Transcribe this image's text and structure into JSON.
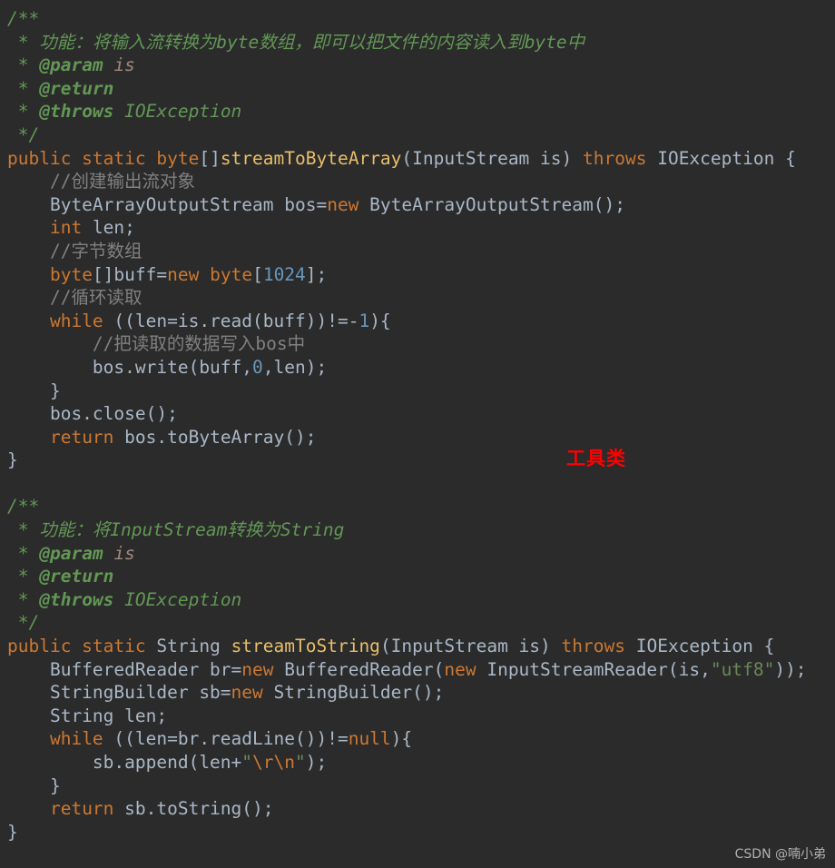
{
  "editor": {
    "background_color": "#2b2b2b",
    "default_text_color": "#a9b7c6",
    "language": "Java",
    "lines": [
      {
        "tokens": [
          {
            "t": "/**",
            "c": "t-doc"
          }
        ]
      },
      {
        "tokens": [
          {
            "t": " * ",
            "c": "t-doc"
          },
          {
            "t": "功能：将输入流转换为byte数组，即可以把文件的内容读入到byte中",
            "c": "t-doc"
          }
        ]
      },
      {
        "tokens": [
          {
            "t": " * ",
            "c": "t-doc"
          },
          {
            "t": "@param",
            "c": "t-doctag"
          },
          {
            "t": " ",
            "c": "t-doc"
          },
          {
            "t": "is",
            "c": "t-docparam"
          }
        ]
      },
      {
        "tokens": [
          {
            "t": " * ",
            "c": "t-doc"
          },
          {
            "t": "@return",
            "c": "t-doctag"
          }
        ]
      },
      {
        "tokens": [
          {
            "t": " * ",
            "c": "t-doc"
          },
          {
            "t": "@throws",
            "c": "t-doctag"
          },
          {
            "t": " IOException",
            "c": "t-doc"
          }
        ]
      },
      {
        "tokens": [
          {
            "t": " */",
            "c": "t-doc"
          }
        ]
      },
      {
        "tokens": [
          {
            "t": "public static ",
            "c": "t-kw"
          },
          {
            "t": "byte",
            "c": "t-kw"
          },
          {
            "t": "[]",
            "c": "t-punct"
          },
          {
            "t": "streamToByteArray",
            "c": "t-method"
          },
          {
            "t": "(InputStream is) ",
            "c": "t-plain"
          },
          {
            "t": "throws",
            "c": "t-kw"
          },
          {
            "t": " IOException {",
            "c": "t-plain"
          }
        ]
      },
      {
        "tokens": [
          {
            "t": "    //创建输出流对象",
            "c": "t-comment"
          }
        ]
      },
      {
        "tokens": [
          {
            "t": "    ByteArrayOutputStream bos=",
            "c": "t-plain"
          },
          {
            "t": "new",
            "c": "t-kw"
          },
          {
            "t": " ByteArrayOutputStream();",
            "c": "t-plain"
          }
        ]
      },
      {
        "tokens": [
          {
            "t": "    ",
            "c": "t-plain"
          },
          {
            "t": "int",
            "c": "t-kw"
          },
          {
            "t": " len;",
            "c": "t-plain"
          }
        ]
      },
      {
        "tokens": [
          {
            "t": "    //字节数组",
            "c": "t-comment"
          }
        ]
      },
      {
        "tokens": [
          {
            "t": "    ",
            "c": "t-plain"
          },
          {
            "t": "byte",
            "c": "t-kw"
          },
          {
            "t": "[]",
            "c": "t-punct"
          },
          {
            "t": "buff=",
            "c": "t-plain"
          },
          {
            "t": "new",
            "c": "t-kw"
          },
          {
            "t": " ",
            "c": "t-plain"
          },
          {
            "t": "byte",
            "c": "t-kw"
          },
          {
            "t": "[",
            "c": "t-plain"
          },
          {
            "t": "1024",
            "c": "t-num"
          },
          {
            "t": "];",
            "c": "t-plain"
          }
        ]
      },
      {
        "tokens": [
          {
            "t": "    //循环读取",
            "c": "t-comment"
          }
        ]
      },
      {
        "tokens": [
          {
            "t": "    ",
            "c": "t-plain"
          },
          {
            "t": "while",
            "c": "t-kw"
          },
          {
            "t": " ((len=is.read(buff))!=-",
            "c": "t-plain"
          },
          {
            "t": "1",
            "c": "t-num"
          },
          {
            "t": "){",
            "c": "t-plain"
          }
        ]
      },
      {
        "tokens": [
          {
            "t": "        //把读取的数据写入bos中",
            "c": "t-comment"
          }
        ]
      },
      {
        "tokens": [
          {
            "t": "        bos.write(buff,",
            "c": "t-plain"
          },
          {
            "t": "0",
            "c": "t-num"
          },
          {
            "t": ",len);",
            "c": "t-plain"
          }
        ]
      },
      {
        "tokens": [
          {
            "t": "    }",
            "c": "t-plain"
          }
        ]
      },
      {
        "tokens": [
          {
            "t": "    bos.close();",
            "c": "t-plain"
          }
        ]
      },
      {
        "tokens": [
          {
            "t": "    ",
            "c": "t-plain"
          },
          {
            "t": "return",
            "c": "t-kw"
          },
          {
            "t": " bos.toByteArray();",
            "c": "t-plain"
          }
        ]
      },
      {
        "tokens": [
          {
            "t": "}",
            "c": "t-plain"
          }
        ]
      },
      {
        "tokens": [
          {
            "t": "",
            "c": "t-plain"
          }
        ]
      },
      {
        "tokens": [
          {
            "t": "/**",
            "c": "t-doc"
          }
        ]
      },
      {
        "tokens": [
          {
            "t": " * ",
            "c": "t-doc"
          },
          {
            "t": "功能：将InputStream转换为String",
            "c": "t-doc"
          }
        ]
      },
      {
        "tokens": [
          {
            "t": " * ",
            "c": "t-doc"
          },
          {
            "t": "@param",
            "c": "t-doctag"
          },
          {
            "t": " ",
            "c": "t-doc"
          },
          {
            "t": "is",
            "c": "t-docparam"
          }
        ]
      },
      {
        "tokens": [
          {
            "t": " * ",
            "c": "t-doc"
          },
          {
            "t": "@return",
            "c": "t-doctag"
          }
        ]
      },
      {
        "tokens": [
          {
            "t": " * ",
            "c": "t-doc"
          },
          {
            "t": "@throws",
            "c": "t-doctag"
          },
          {
            "t": " IOException",
            "c": "t-doc"
          }
        ]
      },
      {
        "tokens": [
          {
            "t": " */",
            "c": "t-doc"
          }
        ]
      },
      {
        "tokens": [
          {
            "t": "public static ",
            "c": "t-kw"
          },
          {
            "t": "String ",
            "c": "t-plain"
          },
          {
            "t": "streamToString",
            "c": "t-method"
          },
          {
            "t": "(InputStream is) ",
            "c": "t-plain"
          },
          {
            "t": "throws",
            "c": "t-kw"
          },
          {
            "t": " IOException {",
            "c": "t-plain"
          }
        ]
      },
      {
        "tokens": [
          {
            "t": "    BufferedReader br=",
            "c": "t-plain"
          },
          {
            "t": "new",
            "c": "t-kw"
          },
          {
            "t": " BufferedReader(",
            "c": "t-plain"
          },
          {
            "t": "new",
            "c": "t-kw"
          },
          {
            "t": " InputStreamReader(is,",
            "c": "t-plain"
          },
          {
            "t": "\"utf8\"",
            "c": "t-str"
          },
          {
            "t": "));",
            "c": "t-plain"
          }
        ]
      },
      {
        "tokens": [
          {
            "t": "    StringBuilder sb=",
            "c": "t-plain"
          },
          {
            "t": "new",
            "c": "t-kw"
          },
          {
            "t": " StringBuilder();",
            "c": "t-plain"
          }
        ]
      },
      {
        "tokens": [
          {
            "t": "    String len;",
            "c": "t-plain"
          }
        ]
      },
      {
        "tokens": [
          {
            "t": "    ",
            "c": "t-plain"
          },
          {
            "t": "while",
            "c": "t-kw"
          },
          {
            "t": " ((len=br.readLine())!=",
            "c": "t-plain"
          },
          {
            "t": "null",
            "c": "t-kw"
          },
          {
            "t": "){",
            "c": "t-plain"
          }
        ]
      },
      {
        "tokens": [
          {
            "t": "        sb.append(len+",
            "c": "t-plain"
          },
          {
            "t": "\"",
            "c": "t-str"
          },
          {
            "t": "\\r\\n",
            "c": "t-esc"
          },
          {
            "t": "\"",
            "c": "t-str"
          },
          {
            "t": ");",
            "c": "t-plain"
          }
        ]
      },
      {
        "tokens": [
          {
            "t": "    }",
            "c": "t-plain"
          }
        ]
      },
      {
        "tokens": [
          {
            "t": "    ",
            "c": "t-plain"
          },
          {
            "t": "return",
            "c": "t-kw"
          },
          {
            "t": " sb.toString();",
            "c": "t-plain"
          }
        ]
      },
      {
        "tokens": [
          {
            "t": "}",
            "c": "t-plain"
          }
        ]
      }
    ]
  },
  "annotations": {
    "utility_class": {
      "label": "工具类",
      "color": "#ff0000"
    }
  },
  "watermark": {
    "text": "CSDN @喃小弟",
    "color": "#c8c8c8"
  }
}
